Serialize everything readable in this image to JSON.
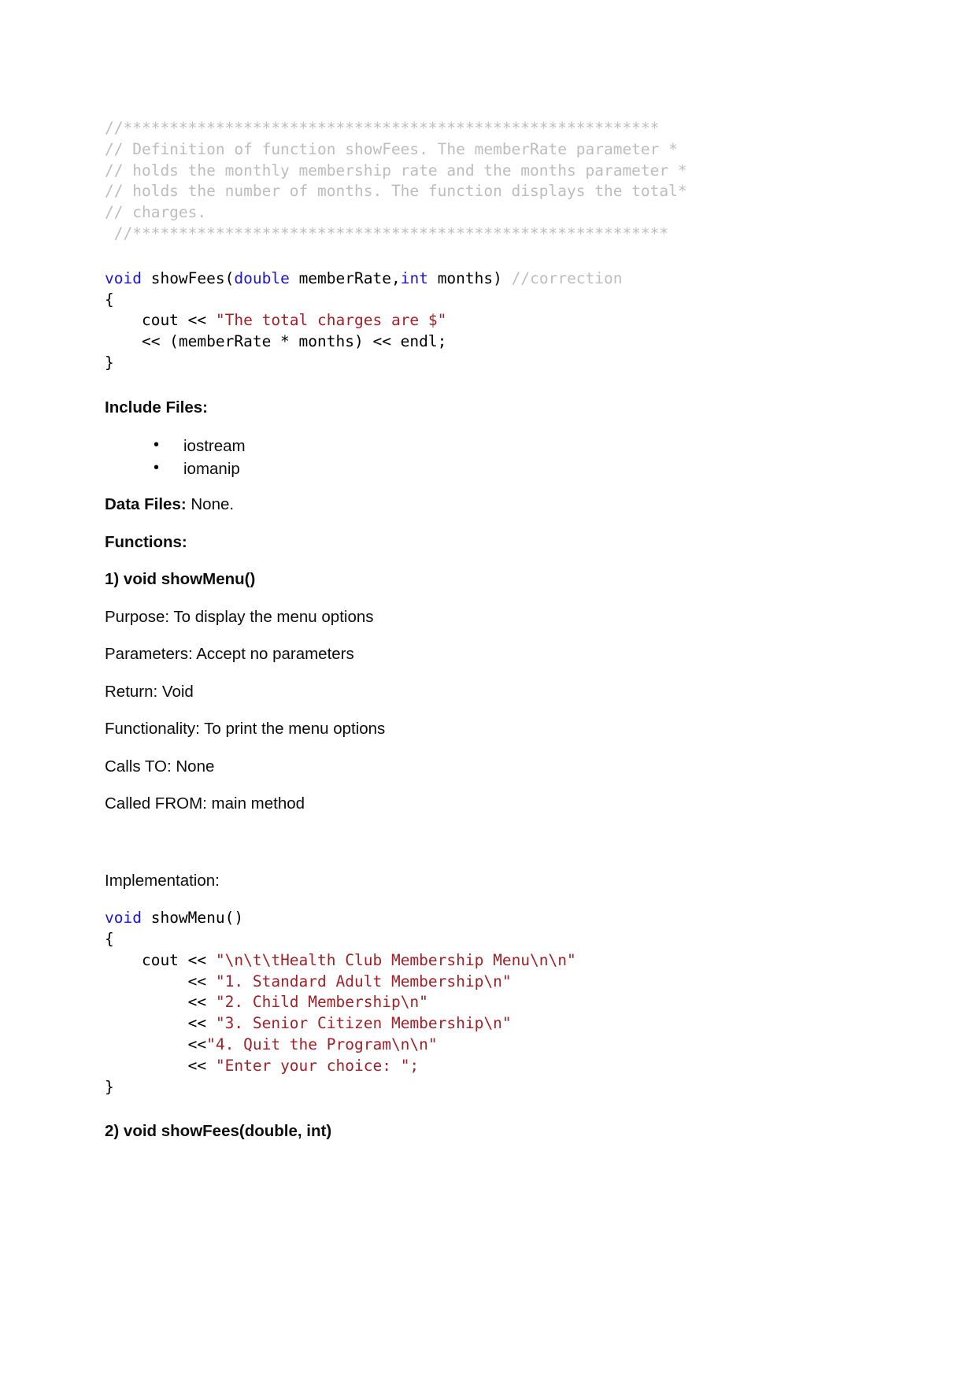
{
  "document": {
    "top_comment_block": {
      "lines": [
        "//**********************************************************",
        "// Definition of function showFees. The memberRate parameter *",
        "// holds the monthly membership rate and the months parameter *",
        "// holds the number of months. The function displays the total*",
        "// charges.",
        " //**********************************************************"
      ]
    },
    "showfees_code": {
      "signature_kw_void": "void",
      "signature_name": " showFees(",
      "signature_kw_double": "double",
      "signature_mid": " memberRate,",
      "signature_kw_int": "int",
      "signature_tail": " months) ",
      "signature_comment": "//correction",
      "brace_open": "{",
      "cout_indent": "    cout << ",
      "cout_string": "\"The total charges are $\"",
      "line_expr": "    << (memberRate * months) << endl;",
      "brace_close": "}"
    },
    "include_files": {
      "heading": "Include Files:",
      "items": [
        "iostream",
        "iomanip"
      ]
    },
    "data_files": {
      "label": "Data Files:",
      "value": " None."
    },
    "functions_heading": "Functions:",
    "function_1": {
      "title": "1) void showMenu()",
      "purpose": "Purpose: To display the menu options",
      "parameters": "Parameters: Accept no parameters",
      "return": "Return: Void",
      "functionality": "Functionality: To print the menu options",
      "calls_to": "Calls TO: None",
      "called_from": "Called FROM: main method",
      "implementation_label": "Implementation:"
    },
    "showmenu_code": {
      "kw_void": "void",
      "name": " showMenu()",
      "brace_open": "{",
      "cout_indent": "    cout << ",
      "cout_string_1": "\"\\n\\t\\tHealth Club Membership Menu\\n\\n\"",
      "line2_indent": "         << ",
      "cout_string_2": "\"1. Standard Adult Membership\\n\"",
      "line3_indent": "         << ",
      "cout_string_3": "\"2. Child Membership\\n\"",
      "line4_indent": "         << ",
      "cout_string_4": "\"3. Senior Citizen Membership\\n\"",
      "line5_indent": "         <<",
      "cout_string_5": "\"4. Quit the Program\\n\\n\"",
      "line6_indent": "         << ",
      "cout_string_6": "\"Enter your choice: \";",
      "brace_close": "}"
    },
    "function_2": {
      "title": "2) void showFees(double, int)"
    },
    "colors": {
      "comment_gray": "#bdbdbd",
      "keyword_blue": "#1a14d6",
      "string_red": "#a02128",
      "text_black": "#0d0d0d",
      "page_background": "#ffffff"
    }
  }
}
